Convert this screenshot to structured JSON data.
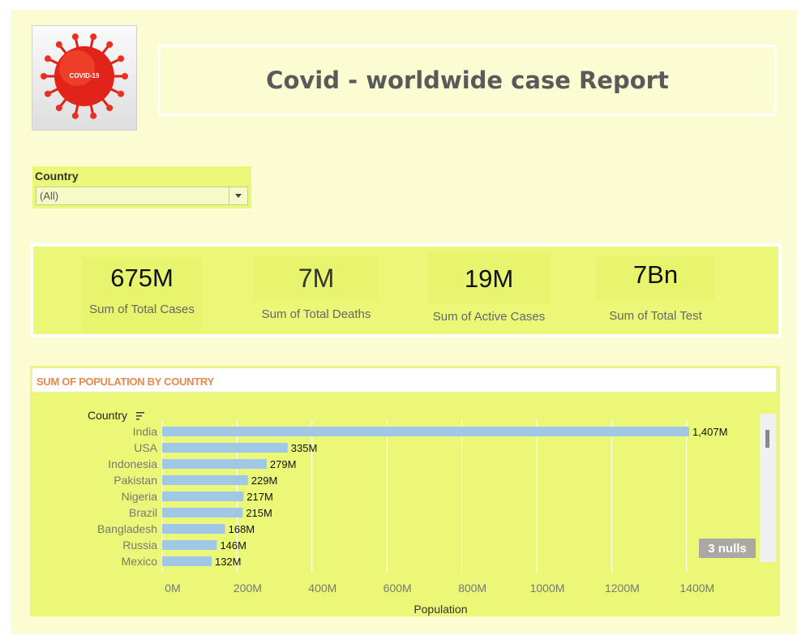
{
  "header": {
    "title": "Covid - worldwide case Report"
  },
  "logo": {
    "icon": "covid-virus-icon",
    "text": "COVID-19"
  },
  "filter": {
    "label": "Country",
    "value": "(All)"
  },
  "kpis": [
    {
      "value": "675M",
      "label": "Sum of Total Cases"
    },
    {
      "value": "7M",
      "label": "Sum of Total Deaths"
    },
    {
      "value": "19M",
      "label": "Sum of Active Cases"
    },
    {
      "value": "7Bn",
      "label": "Sum of Total Test"
    }
  ],
  "chart": {
    "heading": "SUM OF POPULATION BY COUNTRY",
    "nulls_label": "3 nulls"
  },
  "colors": {
    "bar": "#a0c8e6",
    "background": "#fbfcd1",
    "panel": "#ebf877",
    "title_accent": "#e8884a"
  },
  "chart_data": {
    "type": "bar",
    "orientation": "horizontal",
    "title": "SUM OF POPULATION BY COUNTRY",
    "ylabel": "Country",
    "xlabel": "Population",
    "categories": [
      "India",
      "USA",
      "Indonesia",
      "Pakistan",
      "Nigeria",
      "Brazil",
      "Bangladesh",
      "Russia",
      "Mexico"
    ],
    "values": [
      1407,
      335,
      279,
      229,
      217,
      215,
      168,
      146,
      132
    ],
    "data_labels": [
      "1,407M",
      "335M",
      "279M",
      "229M",
      "217M",
      "215M",
      "168M",
      "146M",
      "132M"
    ],
    "x_ticks": [
      "0M",
      "200M",
      "400M",
      "600M",
      "800M",
      "1000M",
      "1200M",
      "1400M"
    ],
    "xlim": [
      0,
      1600
    ],
    "grid": true,
    "sorted": "descending"
  }
}
